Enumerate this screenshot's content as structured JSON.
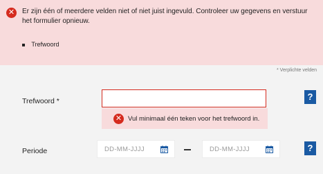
{
  "error_summary": {
    "icon": "error-x-icon",
    "message": "Er zijn één of meerdere velden niet of niet juist ingevuld. Controleer uw gegevens en verstuur het formulier opnieuw.",
    "items": [
      "Trefwoord"
    ]
  },
  "required_note": "* Verplichte velden",
  "keyword_field": {
    "label": "Trefwoord *",
    "value": "",
    "error_message": "Vul minimaal één teken voor het trefwoord in.",
    "help_label": "?"
  },
  "period_field": {
    "label": "Periode",
    "from_placeholder": "DD-MM-JJJJ",
    "to_placeholder": "DD-MM-JJJJ",
    "help_label": "?"
  },
  "colors": {
    "error": "#d52b1e",
    "error_bg": "#f8dbdc",
    "help_button": "#1a5aa3",
    "calendar_icon": "#1a5aa3"
  }
}
